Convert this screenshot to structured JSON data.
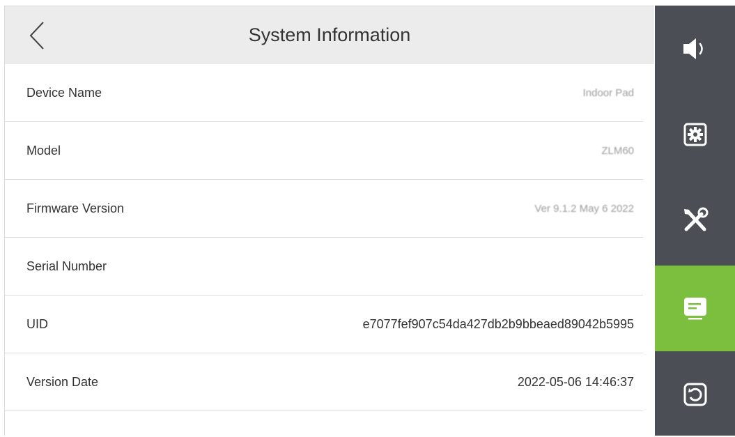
{
  "header": {
    "title": "System Information",
    "back_icon": "chevron-left-icon"
  },
  "info_rows": [
    {
      "label": "Device Name",
      "value": "Indoor Pad"
    },
    {
      "label": "Model",
      "value": "ZLM60"
    },
    {
      "label": "Firmware Version",
      "value": "Ver 9.1.2 May 6 2022"
    },
    {
      "label": "Serial Number",
      "value": ""
    },
    {
      "label": "UID",
      "value": "e7077fef907c54da427db2b9bbeaed89042b5995"
    },
    {
      "label": "Version Date",
      "value": "2022-05-06 14:46:37"
    }
  ],
  "sidebar": {
    "items": [
      {
        "icon": "speaker-icon",
        "active": false
      },
      {
        "icon": "gear-icon",
        "active": false
      },
      {
        "icon": "tools-icon",
        "active": false
      },
      {
        "icon": "info-icon",
        "active": true
      },
      {
        "icon": "restore-icon",
        "active": false
      }
    ]
  },
  "colors": {
    "sidebar_bg": "#4b4f55",
    "active_accent": "#7cbf3f",
    "header_bg": "#ececec"
  }
}
